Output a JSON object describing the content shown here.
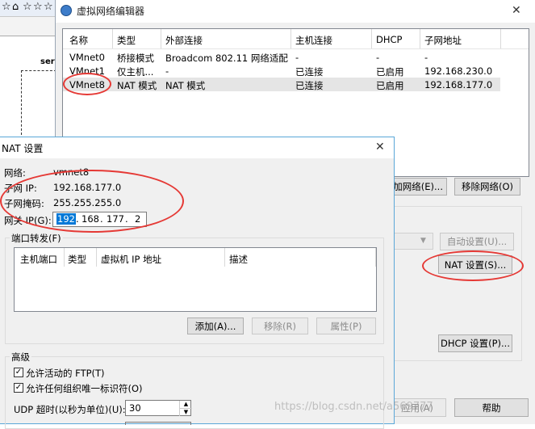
{
  "bg_window": {
    "toolbar_icons": [
      "☆",
      "⌂",
      "☆",
      "☆",
      "☆"
    ],
    "sidebar_label": "serv"
  },
  "editor": {
    "title": "虚拟网络编辑器",
    "close": "✕",
    "table": {
      "headers": [
        "名称",
        "类型",
        "外部连接",
        "主机连接",
        "DHCP",
        "子网地址"
      ],
      "rows": [
        [
          "VMnet0",
          "桥接模式",
          "Broadcom 802.11 网络适配...",
          "-",
          "-",
          "-"
        ],
        [
          "VMnet1",
          "仅主机...",
          "-",
          "已连接",
          "已启用",
          "192.168.230.0"
        ],
        [
          "VMnet8",
          "NAT 模式",
          "NAT 模式",
          "已连接",
          "已启用",
          "192.168.177.0"
        ]
      ]
    },
    "add_network": "加网络(E)...",
    "remove_network": "移除网络(O)",
    "auto_settings": "自动设置(U)...",
    "nat_settings": "NAT 设置(S)...",
    "dhcp_settings": "DHCP 设置(P)...",
    "apply": "应用(A)",
    "help": "帮助"
  },
  "nat": {
    "title": "NAT 设置",
    "close": "✕",
    "network_label": "网络:",
    "network_value": "vmnet8",
    "subnet_ip_label": "子网 IP:",
    "subnet_ip_value": "192.168.177.0",
    "mask_label": "子网掩码:",
    "mask_value": "255.255.255.0",
    "gateway_label": "网关 IP(G):",
    "gateway_octets": [
      "192",
      "168",
      "177",
      "2"
    ],
    "port_forward_title": "端口转发(F)",
    "pf_headers": [
      "主机端口",
      "类型",
      "虚拟机 IP 地址",
      "描述"
    ],
    "add": "添加(A)...",
    "remove": "移除(R)",
    "properties": "属性(P)",
    "advanced_title": "高级",
    "ftp_label": "允许活动的 FTP(T)",
    "oui_label": "允许任何组织唯一标识符(O)",
    "udp_label": "UDP 超时(以秒为单位)(U):",
    "udp_value": "30"
  },
  "watermark": "https://blog.csdn.net/a569777",
  "colors": {
    "highlight": "#e53935",
    "selection": "#0078d7",
    "selected_row": "#e5e5e5"
  }
}
